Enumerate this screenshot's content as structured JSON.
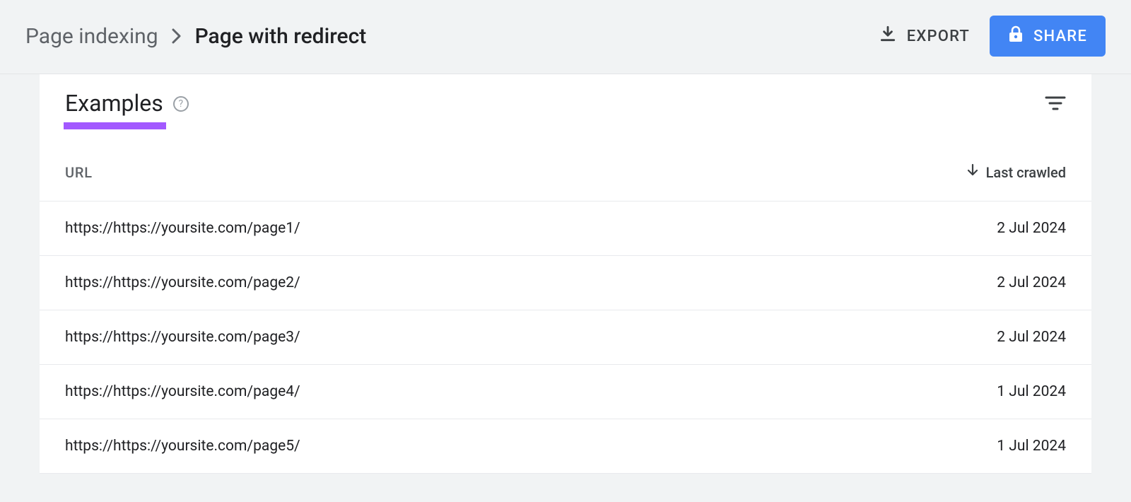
{
  "breadcrumb": {
    "parent": "Page indexing",
    "current": "Page with redirect"
  },
  "actions": {
    "export_label": "EXPORT",
    "share_label": "SHARE"
  },
  "panel": {
    "title": "Examples",
    "help_glyph": "?"
  },
  "table": {
    "col_url": "URL",
    "col_crawled": "Last crawled",
    "rows": [
      {
        "url": "https://https://yoursite.com/page1/",
        "crawled": "2 Jul 2024"
      },
      {
        "url": "https://https://yoursite.com/page2/",
        "crawled": "2 Jul 2024"
      },
      {
        "url": "https://https://yoursite.com/page3/",
        "crawled": "2 Jul 2024"
      },
      {
        "url": "https://https://yoursite.com/page4/",
        "crawled": "1 Jul 2024"
      },
      {
        "url": "https://https://yoursite.com/page5/",
        "crawled": "1 Jul 2024"
      }
    ]
  }
}
